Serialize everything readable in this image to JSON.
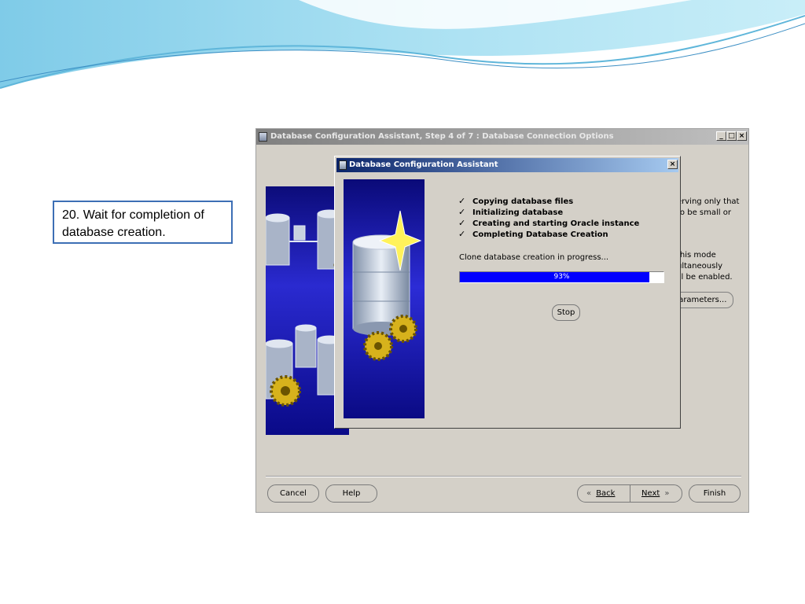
{
  "callout": {
    "text": "20. Wait for completion of database creation."
  },
  "main_window": {
    "title": "Database Configuration Assistant, Step 4 of 7 : Database Connection Options",
    "controls": {
      "minimize": "_",
      "maximize": "□",
      "close": "×"
    },
    "partial_text": [
      "erving only that",
      "to be small or",
      "this mode",
      "ultaneously",
      "ill be enabled."
    ],
    "parameters_button": "Parameters...",
    "buttons": {
      "cancel": "Cancel",
      "help": "Help",
      "back": "Back",
      "next": "Next",
      "finish": "Finish"
    }
  },
  "dialog": {
    "title": "Database Configuration Assistant",
    "close": "×",
    "steps": [
      {
        "label": "Copying database files",
        "done": true
      },
      {
        "label": "Initializing database",
        "done": true
      },
      {
        "label": "Creating and starting Oracle instance",
        "done": true
      },
      {
        "label": "Completing Database Creation",
        "done": true
      }
    ],
    "check_glyph": "✓",
    "progress_label": "Clone database creation in progress...",
    "progress": {
      "percent": 93,
      "text": "93%"
    },
    "stop_button": "Stop"
  },
  "colors": {
    "progress_fill": "#0000ff",
    "dialog_title_start": "#0a246a",
    "dialog_title_end": "#a6caf0",
    "window_bg": "#d4d0c8",
    "callout_border": "#3d6fb5"
  },
  "icons": [
    "app-icon",
    "minimize-icon",
    "maximize-icon",
    "close-icon",
    "check-icon",
    "back-arrow-icon",
    "next-arrow-icon",
    "database-gears-illustration",
    "wave-decoration"
  ]
}
